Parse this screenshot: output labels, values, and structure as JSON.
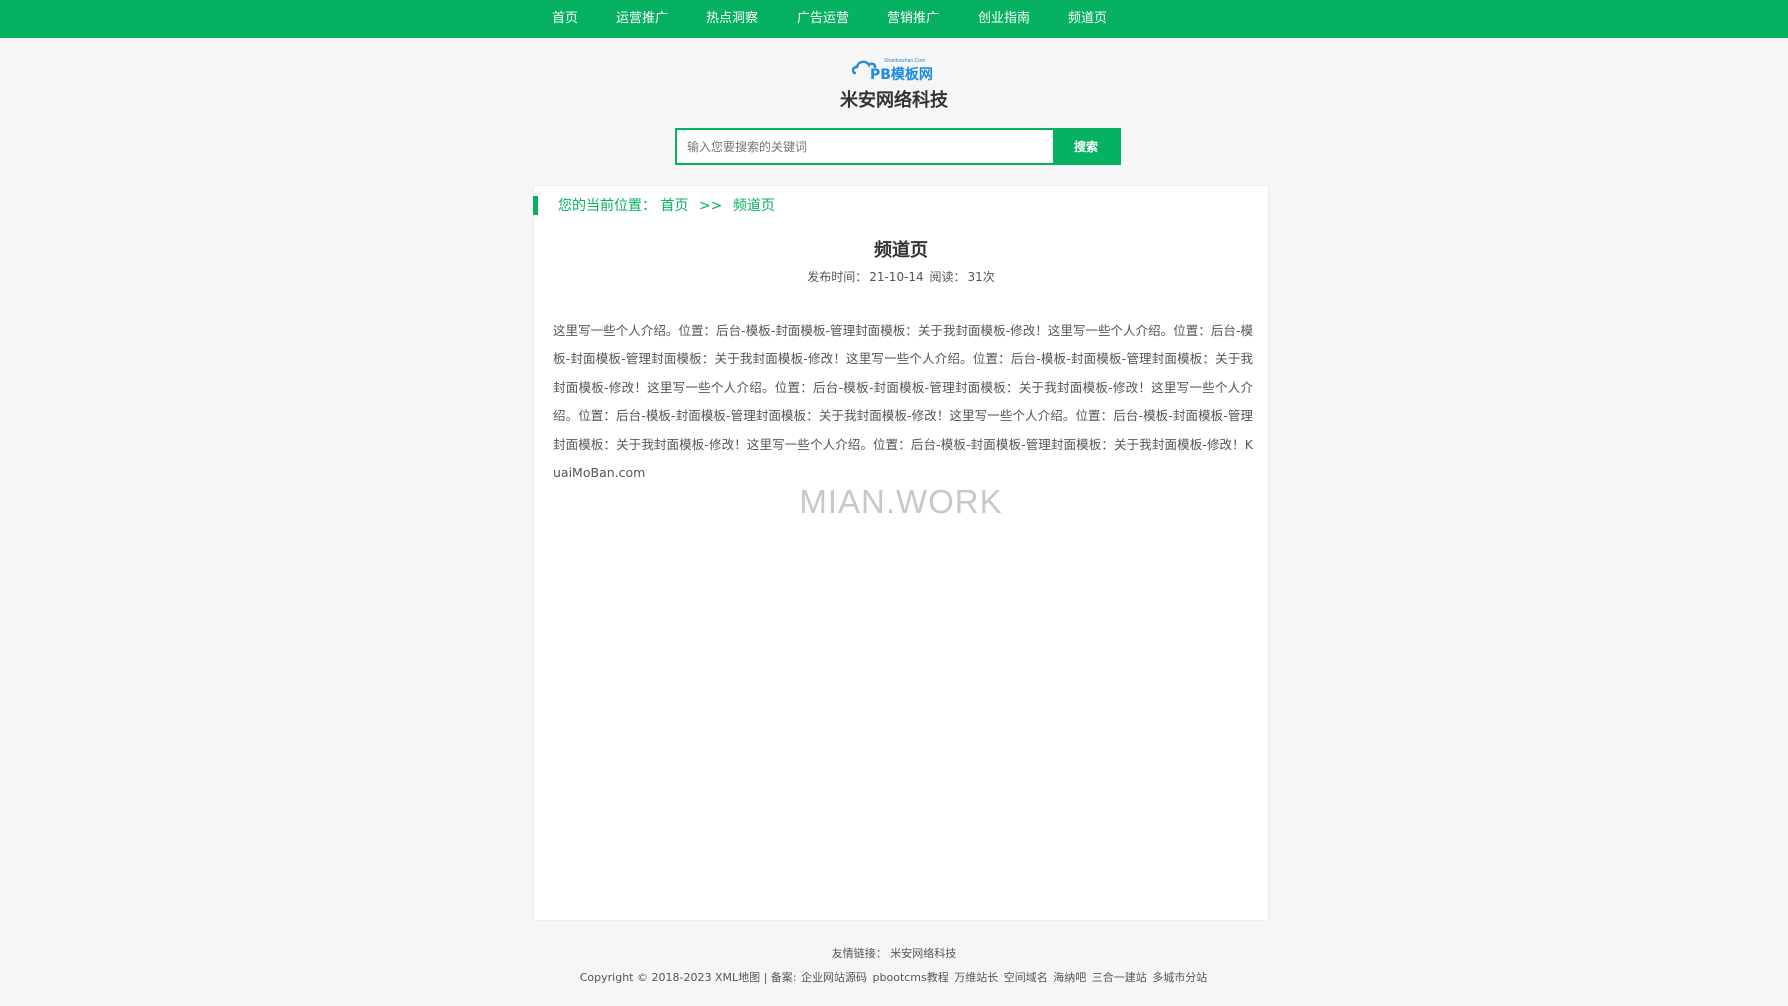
{
  "nav": {
    "items": [
      "首页",
      "运营推广",
      "热点洞察",
      "广告运营",
      "营销推广",
      "创业指南",
      "频道页"
    ]
  },
  "logo": {
    "small_text": "Shanbeizhan.Com",
    "main_text": "PB模板网"
  },
  "site": {
    "name": "米安网络科技"
  },
  "search": {
    "placeholder": "输入您要搜索的关键词",
    "button_label": "搜索"
  },
  "breadcrumb": {
    "prefix": "您的当前位置：",
    "home": "首页",
    "separator": ">>",
    "current": "频道页"
  },
  "article": {
    "title": "频道页",
    "publish_label": "发布时间：",
    "publish_date": "21-10-14",
    "read_label": "阅读：",
    "read_count": "31次",
    "body": "这里写一些个人介绍。位置：后台-模板-封面模板-管理封面模板：关于我封面模板-修改！这里写一些个人介绍。位置：后台-模板-封面模板-管理封面模板：关于我封面模板-修改！这里写一些个人介绍。位置：后台-模板-封面模板-管理封面模板：关于我封面模板-修改！这里写一些个人介绍。位置：后台-模板-封面模板-管理封面模板：关于我封面模板-修改！这里写一些个人介绍。位置：后台-模板-封面模板-管理封面模板：关于我封面模板-修改！这里写一些个人介绍。位置：后台-模板-封面模板-管理封面模板：关于我封面模板-修改！这里写一些个人介绍。位置：后台-模板-封面模板-管理封面模板：关于我封面模板-修改！KuaiMoBan.com",
    "watermark": "MIAN.WORK"
  },
  "footer": {
    "friend_label": "友情链接：",
    "friend_links": [
      "米安网络科技"
    ],
    "copyright": "Copyright © 2018-2023 XML地图 | 备案:",
    "links": [
      "企业网站源码",
      "pbootcms教程",
      "万维站长",
      "空间域名",
      "海纳吧",
      "三合一建站",
      "多城市分站"
    ]
  },
  "colors": {
    "brand": "#06b161",
    "logo_blue": "#1e8be0",
    "background": "#f6f6f6"
  }
}
